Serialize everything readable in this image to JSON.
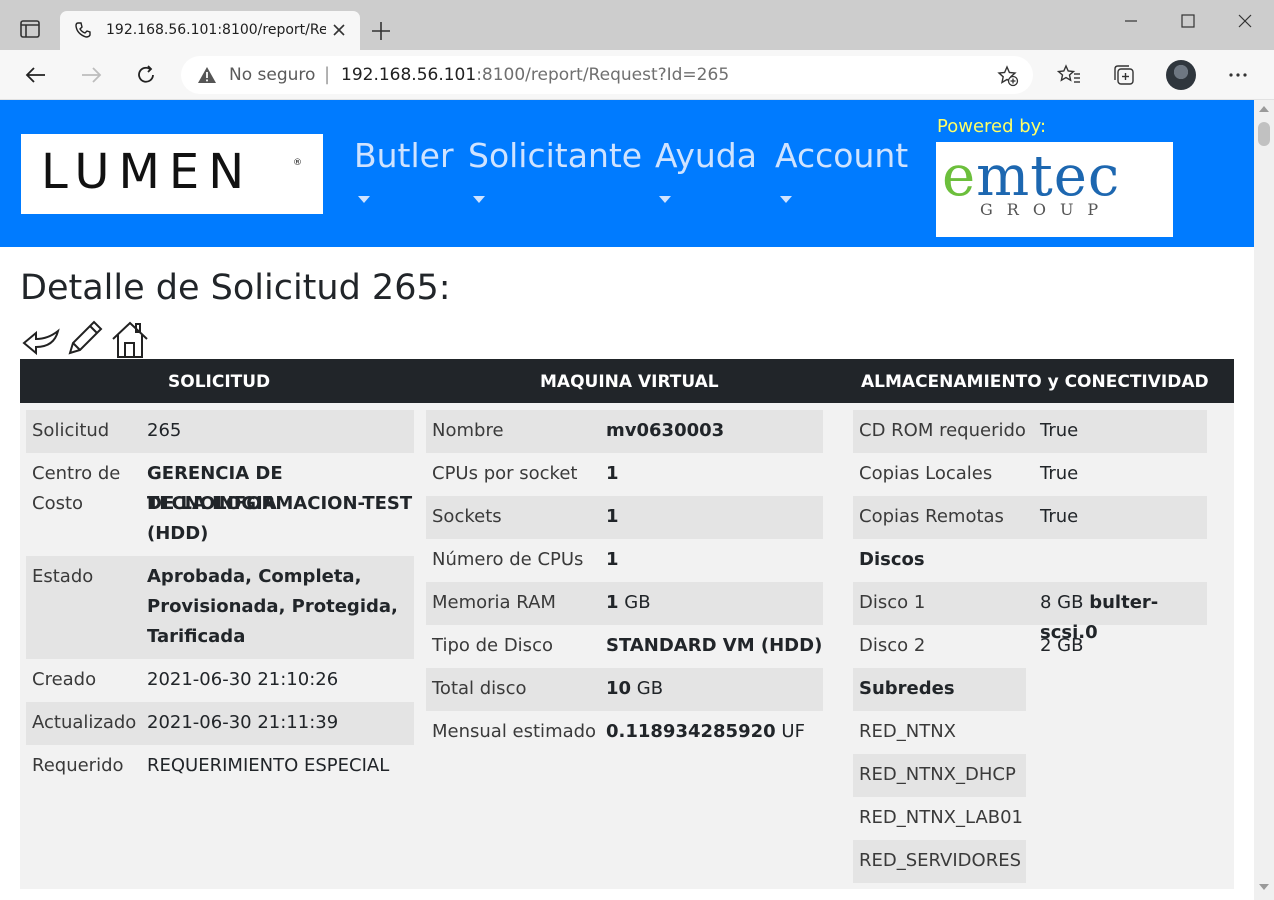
{
  "browser": {
    "tab_title": "192.168.56.101:8100/report/Requ",
    "not_secure": "No seguro",
    "url_host": "192.168.56.101",
    "url_rest": ":8100/report/Request?Id=265"
  },
  "header": {
    "logo_text": "LUMEN",
    "logo_reg": "®",
    "menu": [
      "Butler",
      "Solicitante",
      "Ayuda",
      "Account"
    ],
    "powered_by": "Powered by:",
    "partner_name": "emtec",
    "partner_name_e": "e",
    "partner_name_rest": "mtec",
    "partner_group": "GROUP"
  },
  "page": {
    "title": "Detalle de Solicitud 265:"
  },
  "columns": {
    "solicitud": "SOLICITUD",
    "maquina": "MAQUINA VIRTUAL",
    "almacenamiento": "ALMACENAMIENTO y CONECTIVIDAD"
  },
  "solicitud": {
    "solicitud_label": "Solicitud",
    "solicitud_value": "265",
    "centro_label_1": "Centro de",
    "centro_label_2": "Costo",
    "centro_value_1": "GERENCIA DE TECNOLOGIA",
    "centro_value_2": "DE LA INFORMACION-TEST",
    "centro_value_3": "(HDD)",
    "estado_label": "Estado",
    "estado_value_1": "Aprobada, Completa,",
    "estado_value_2": "Provisionada, Protegida,",
    "estado_value_3": "Tarificada",
    "creado_label": "Creado",
    "creado_value": "2021-06-30 21:10:26",
    "actualizado_label": "Actualizado",
    "actualizado_value": "2021-06-30 21:11:39",
    "requerido_label": "Requerido",
    "requerido_value": "REQUERIMIENTO ESPECIAL"
  },
  "maquina": {
    "nombre_label": "Nombre",
    "nombre_value": "mv0630003",
    "cpus_socket_label": "CPUs por socket",
    "cpus_socket_value": "1",
    "sockets_label": "Sockets",
    "sockets_value": "1",
    "num_cpus_label": "Número de CPUs",
    "num_cpus_value": "1",
    "ram_label": "Memoria RAM",
    "ram_value": "1",
    "ram_unit": "GB",
    "tipo_disco_label": "Tipo de Disco",
    "tipo_disco_value": "STANDARD VM (HDD)",
    "total_disco_label": "Total disco",
    "total_disco_value": "10",
    "total_disco_unit": "GB",
    "mensual_label": "Mensual estimado",
    "mensual_value": "0.118934285920",
    "mensual_unit": "UF"
  },
  "almacenamiento": {
    "cdrom_label": "CD ROM requerido",
    "cdrom_value": "True",
    "copias_locales_label": "Copias Locales",
    "copias_locales_value": "True",
    "copias_remotas_label": "Copias Remotas",
    "copias_remotas_value": "True",
    "discos_heading": "Discos",
    "disco1_label": "Disco 1",
    "disco1_size": "8 GB",
    "disco1_name": "bulter-scsi.0",
    "disco2_label": "Disco 2",
    "disco2_size": "2 GB",
    "subredes_heading": "Subredes",
    "subredes": [
      "RED_NTNX",
      "RED_NTNX_DHCP",
      "RED_NTNX_LAB01",
      "RED_SERVIDORES"
    ]
  }
}
